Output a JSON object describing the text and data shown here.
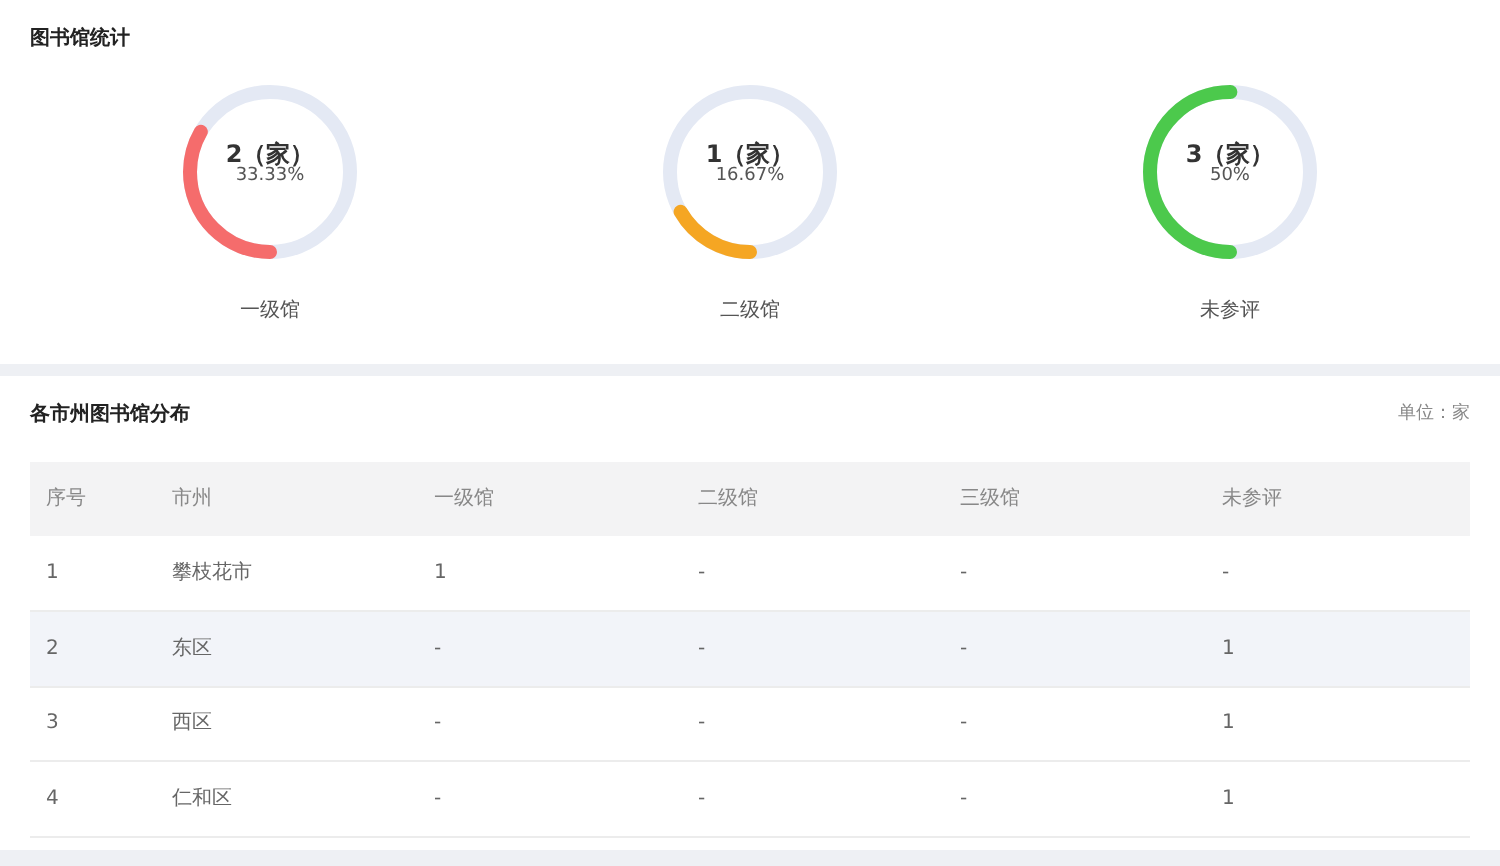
{
  "stats": {
    "title": "图书馆统计",
    "gauges": [
      {
        "count": "2（家）",
        "percent": "33.33%",
        "label": "一级馆",
        "level": 0.3333,
        "color": "#f56c6c"
      },
      {
        "count": "1（家）",
        "percent": "16.67%",
        "label": "二级馆",
        "level": 0.1667,
        "color": "#f5a623"
      },
      {
        "count": "3（家）",
        "percent": "50%",
        "label": "未参评",
        "level": 0.5,
        "color": "#4cc94c"
      }
    ]
  },
  "distribution": {
    "title": "各市州图书馆分布",
    "unit": "单位：家",
    "table": {
      "columns": [
        "序号",
        "市州",
        "一级馆",
        "二级馆",
        "三级馆",
        "未参评"
      ],
      "rows": [
        {
          "cells": [
            "1",
            "攀枝花市",
            "1",
            "-",
            "-",
            "-"
          ],
          "highlighted": false
        },
        {
          "cells": [
            "2",
            "东区",
            "-",
            "-",
            "-",
            "1"
          ],
          "highlighted": true
        },
        {
          "cells": [
            "3",
            "西区",
            "-",
            "-",
            "-",
            "1"
          ],
          "highlighted": false
        },
        {
          "cells": [
            "4",
            "仁和区",
            "-",
            "-",
            "-",
            "1"
          ],
          "highlighted": false
        }
      ]
    }
  }
}
